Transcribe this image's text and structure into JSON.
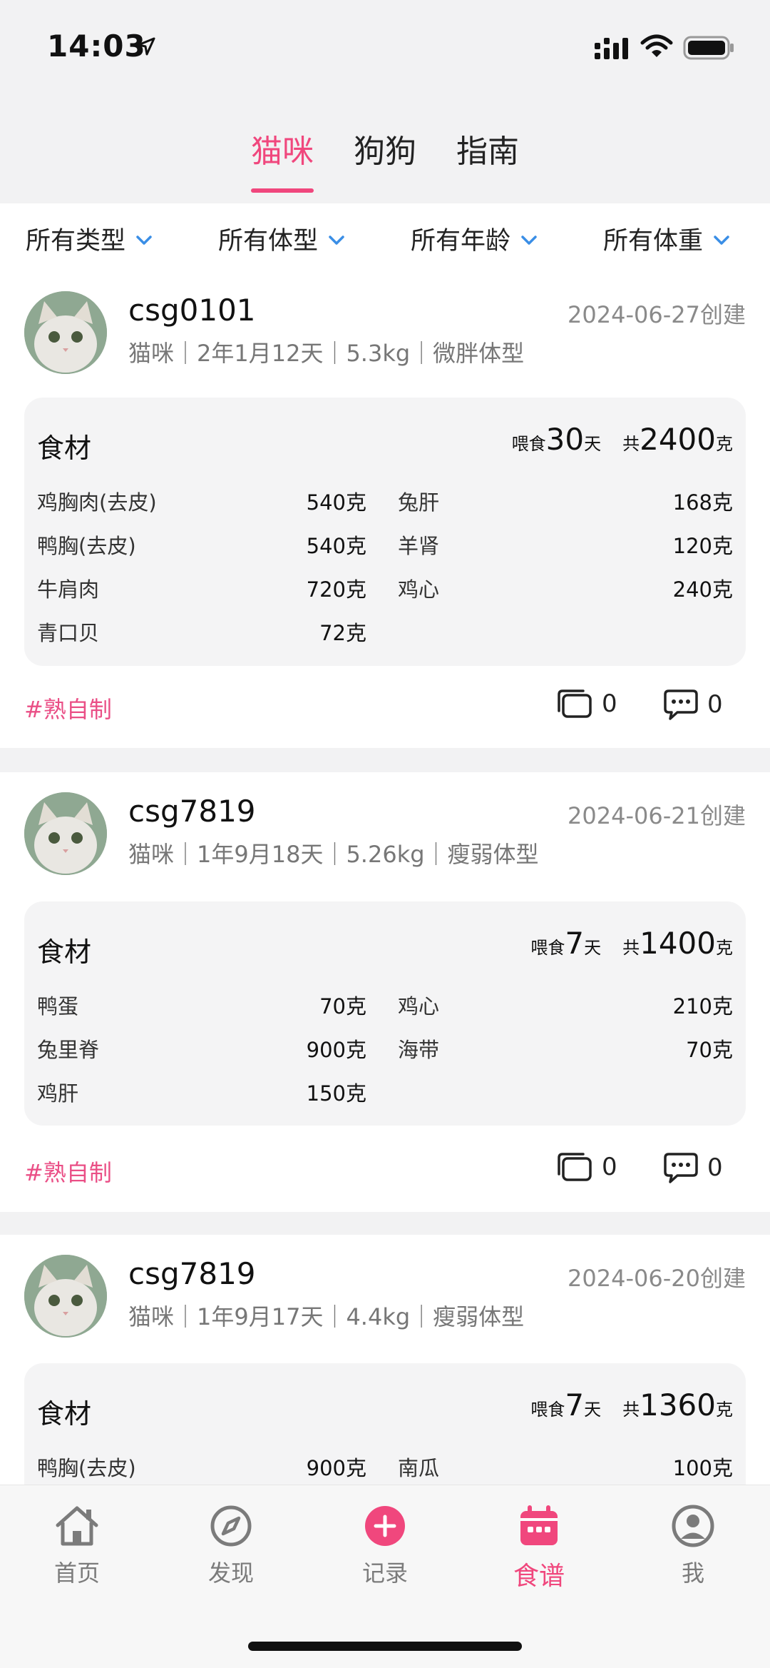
{
  "status_bar": {
    "time": "14:03"
  },
  "tabs": [
    {
      "label": "猫咪",
      "active": true
    },
    {
      "label": "狗狗",
      "active": false
    },
    {
      "label": "指南",
      "active": false
    }
  ],
  "filters": [
    "所有类型",
    "所有体型",
    "所有年龄",
    "所有体重"
  ],
  "accent_color": "#f0477d",
  "tag_color": "#ea4f86",
  "box_title": "食材",
  "feed_label": "喂食",
  "day_unit": "天",
  "total_label": "共",
  "gram_unit": "克",
  "posts": [
    {
      "username": "csg0101",
      "date": "2024-06-27创建",
      "meta": "猫咪｜2年1月12天｜5.3kg｜微胖体型",
      "days": "30",
      "total": "2400",
      "ingredients": [
        {
          "left_name": "鸡胸肉(去皮)",
          "left_amount": "540克",
          "right_name": "兔肝",
          "right_amount": "168克"
        },
        {
          "left_name": "鸭胸(去皮)",
          "left_amount": "540克",
          "right_name": "羊肾",
          "right_amount": "120克"
        },
        {
          "left_name": "牛肩肉",
          "left_amount": "720克",
          "right_name": "鸡心",
          "right_amount": "240克"
        },
        {
          "left_name": "青口贝",
          "left_amount": "72克",
          "right_name": "",
          "right_amount": ""
        }
      ],
      "tag": "#熟自制",
      "collect_count": "0",
      "comment_count": "0"
    },
    {
      "username": "csg7819",
      "date": "2024-06-21创建",
      "meta": "猫咪｜1年9月18天｜5.26kg｜瘦弱体型",
      "days": "7",
      "total": "1400",
      "ingredients": [
        {
          "left_name": "鸭蛋",
          "left_amount": "70克",
          "right_name": "鸡心",
          "right_amount": "210克"
        },
        {
          "left_name": "兔里脊",
          "left_amount": "900克",
          "right_name": "海带",
          "right_amount": "70克"
        },
        {
          "left_name": "鸡肝",
          "left_amount": "150克",
          "right_name": "",
          "right_amount": ""
        }
      ],
      "tag": "#熟自制",
      "collect_count": "0",
      "comment_count": "0"
    },
    {
      "username": "csg7819",
      "date": "2024-06-20创建",
      "meta": "猫咪｜1年9月17天｜4.4kg｜瘦弱体型",
      "days": "7",
      "total": "1360",
      "ingredients": [
        {
          "left_name": "鸭胸(去皮)",
          "left_amount": "900克",
          "right_name": "南瓜",
          "right_amount": "100克"
        }
      ],
      "tag": "",
      "collect_count": "",
      "comment_count": ""
    }
  ],
  "tabbar": [
    {
      "label": "首页",
      "icon": "home-icon",
      "active": false
    },
    {
      "label": "发现",
      "icon": "compass-icon",
      "active": false
    },
    {
      "label": "记录",
      "icon": "plus-circle-icon",
      "active": false
    },
    {
      "label": "食谱",
      "icon": "calendar-icon",
      "active": true
    },
    {
      "label": "我",
      "icon": "profile-icon",
      "active": false
    }
  ]
}
